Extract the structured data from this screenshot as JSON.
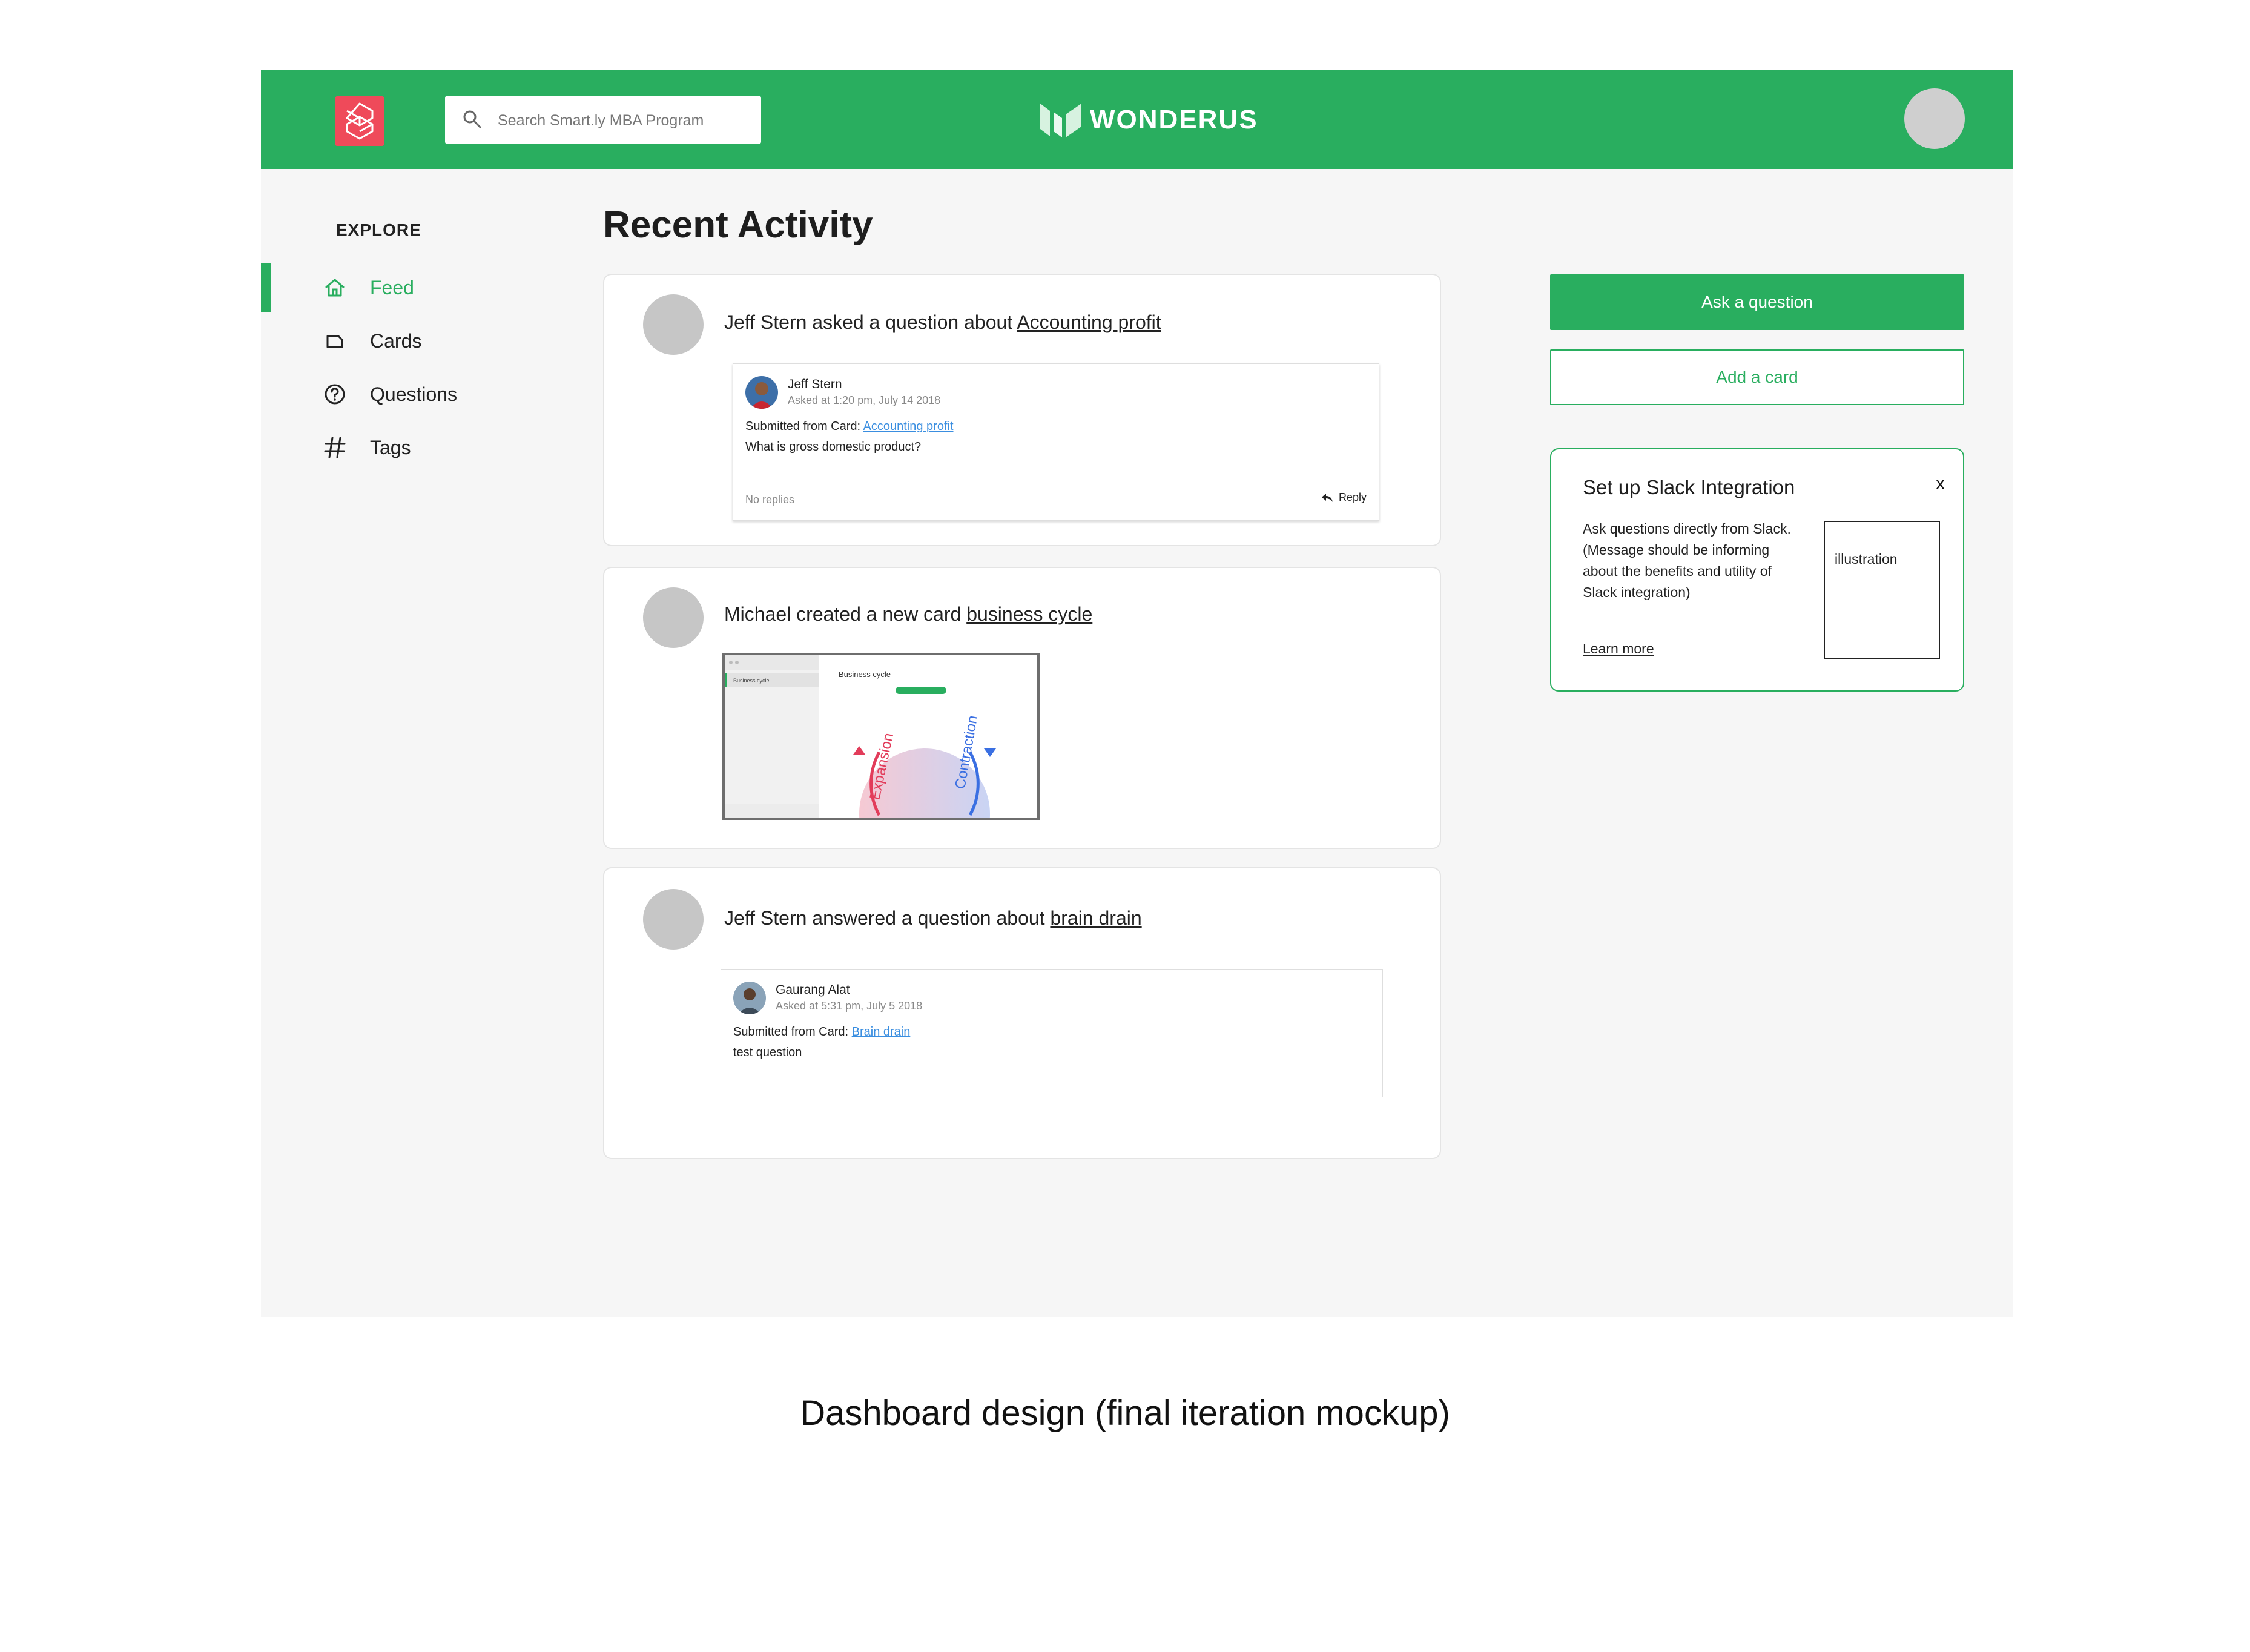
{
  "header": {
    "search_placeholder": "Search Smart.ly MBA Program",
    "brand_name": "WONDERUS",
    "brand_color": "#29ae5f",
    "app_logo_color": "#ef4a5a"
  },
  "sidebar": {
    "section_title": "EXPLORE",
    "items": [
      {
        "label": "Feed",
        "icon": "home-icon",
        "active": true
      },
      {
        "label": "Cards",
        "icon": "card-icon",
        "active": false
      },
      {
        "label": "Questions",
        "icon": "question-circle-icon",
        "active": false
      },
      {
        "label": "Tags",
        "icon": "hash-icon",
        "active": false
      }
    ]
  },
  "main": {
    "title": "Recent Activity",
    "activities": [
      {
        "prefix": "Jeff Stern asked a question about ",
        "link": "Accounting profit",
        "question": {
          "author": "Jeff Stern",
          "time": "Asked at 1:20 pm, July 14 2018",
          "submitted_prefix": "Submitted from Card: ",
          "card_link": "Accounting profit",
          "text": "What is gross domestic product?",
          "replies": "No replies",
          "reply_label": "Reply"
        }
      },
      {
        "prefix": "Michael created a new card ",
        "link": "business cycle",
        "preview": {
          "sidebar_item": "Business cycle",
          "card_title": "Business cycle",
          "label_left": "Expansion",
          "label_right": "Contraction"
        }
      },
      {
        "prefix": "Jeff Stern answered a question about ",
        "link": "brain drain",
        "question": {
          "author": "Gaurang Alat",
          "time": "Asked at 5:31 pm, July 5 2018",
          "submitted_prefix": "Submitted from Card: ",
          "card_link": "Brain drain",
          "text": "test question"
        }
      }
    ]
  },
  "actions": {
    "ask_label": "Ask a question",
    "add_label": "Add a card"
  },
  "slack": {
    "title": "Set up Slack Integration",
    "close": "x",
    "body": "Ask questions directly from Slack. (Message should be informing about the benefits and utility of Slack integration)",
    "learn_more": "Learn more",
    "illustration": "illustration"
  },
  "caption": "Dashboard design (final iteration mockup)"
}
